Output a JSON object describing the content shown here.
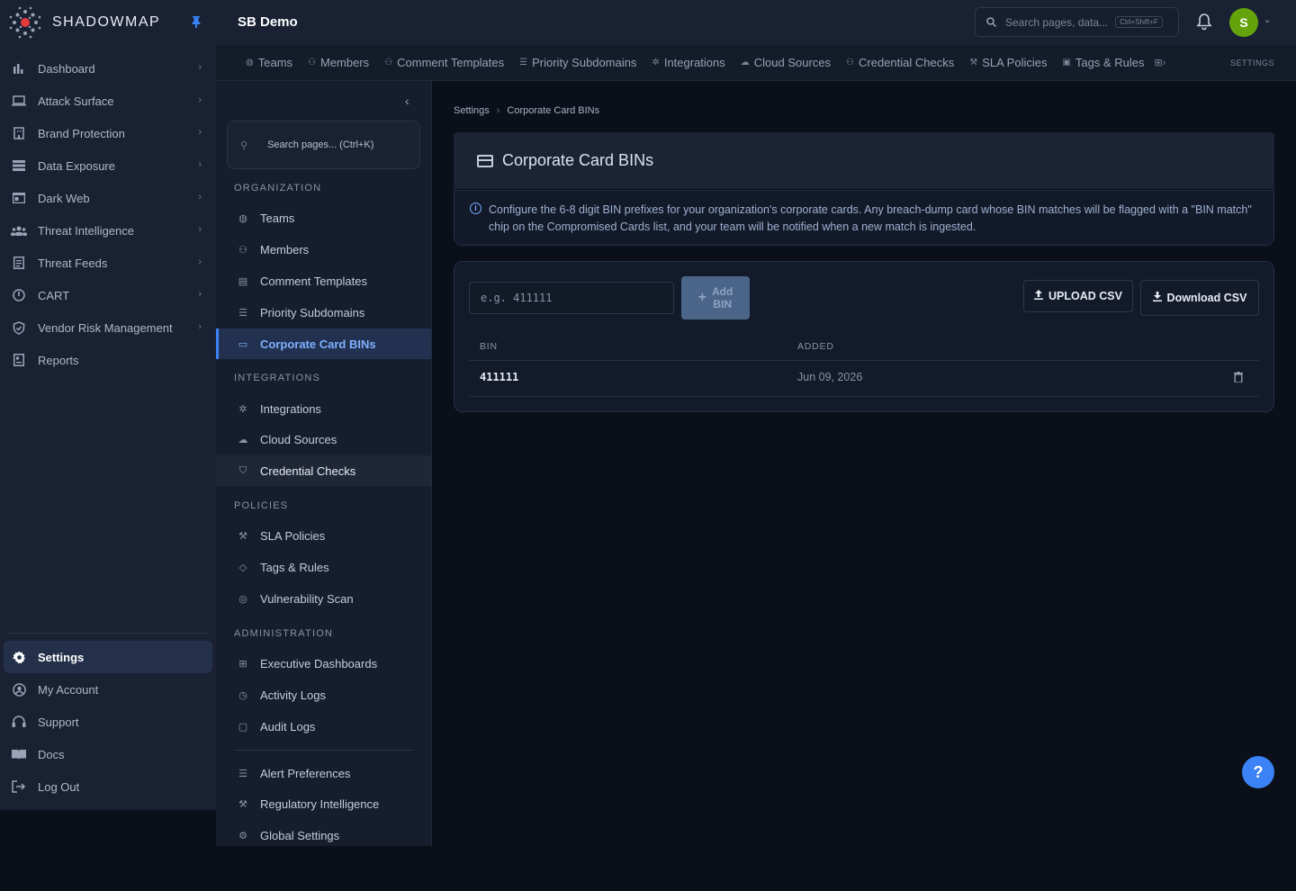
{
  "brand": {
    "name": "SHADOWMAP",
    "accent": "#3b82f6"
  },
  "sidebar": {
    "items": [
      {
        "label": "Dashboard",
        "icon": "bar-chart-icon"
      },
      {
        "label": "Attack Surface",
        "icon": "laptop-icon"
      },
      {
        "label": "Brand Protection",
        "icon": "building-icon"
      },
      {
        "label": "Data Exposure",
        "icon": "server-icon"
      },
      {
        "label": "Dark Web",
        "icon": "web-window-icon"
      },
      {
        "label": "Threat Intelligence",
        "icon": "users-icon"
      },
      {
        "label": "Threat Feeds",
        "icon": "feed-icon"
      },
      {
        "label": "CART",
        "icon": "power-icon"
      },
      {
        "label": "Vendor Risk Management",
        "icon": "shield-icon"
      },
      {
        "label": "Reports",
        "icon": "report-icon"
      }
    ],
    "bottom": [
      {
        "label": "Settings",
        "icon": "gear-icon",
        "active": true
      },
      {
        "label": "My Account",
        "icon": "account-icon"
      },
      {
        "label": "Support",
        "icon": "headset-icon"
      },
      {
        "label": "Docs",
        "icon": "book-icon"
      },
      {
        "label": "Log Out",
        "icon": "logout-icon"
      }
    ]
  },
  "header": {
    "org_title": "SB Demo",
    "search_placeholder": "Search pages, data...",
    "search_shortcut": "Ctrl+Shift+F",
    "avatar_initial": "S",
    "avatar_color": "#65a30d"
  },
  "tabs": [
    "Teams",
    "Members",
    "Comment Templates",
    "Priority Subdomains",
    "Integrations",
    "Cloud Sources",
    "Credential Checks",
    "SLA Policies",
    "Tags & Rules"
  ],
  "tabs_section_label": "SETTINGS",
  "subnav": {
    "search_placeholder": "Search pages... (Ctrl+K)",
    "organization_label": "ORGANIZATION",
    "organization": [
      "Teams",
      "Members",
      "Comment Templates",
      "Priority Subdomains",
      "Corporate Card BINs"
    ],
    "integrations_label": "INTEGRATIONS",
    "integrations": [
      "Integrations",
      "Cloud Sources",
      "Credential Checks"
    ],
    "policies_label": "POLICIES",
    "policies": [
      "SLA Policies",
      "Tags & Rules",
      "Vulnerability Scan"
    ],
    "administration_label": "ADMINISTRATION",
    "administration": [
      "Executive Dashboards",
      "Activity Logs",
      "Audit Logs"
    ],
    "extra": [
      "Alert Preferences",
      "Regulatory Intelligence",
      "Global Settings"
    ]
  },
  "main": {
    "breadcrumb": [
      "Settings",
      "Corporate Card BINs"
    ],
    "title": "Corporate Card BINs",
    "info_text": "Configure the 6-8 digit BIN prefixes for your organization's corporate cards. Any breach-dump card whose BIN matches will be flagged with a \"BIN match\" chip on the Compromised Cards list, and your team will be notified when a new match is ingested.",
    "input_placeholder": "e.g. 411111",
    "add_label_1": "Add",
    "add_label_2": "BIN",
    "upload_label": "UPLOAD CSV",
    "download_label": "Download CSV",
    "columns": [
      "BIN",
      "ADDED"
    ],
    "rows": [
      {
        "bin": "411111",
        "added": "Jun 09, 2026"
      }
    ]
  }
}
